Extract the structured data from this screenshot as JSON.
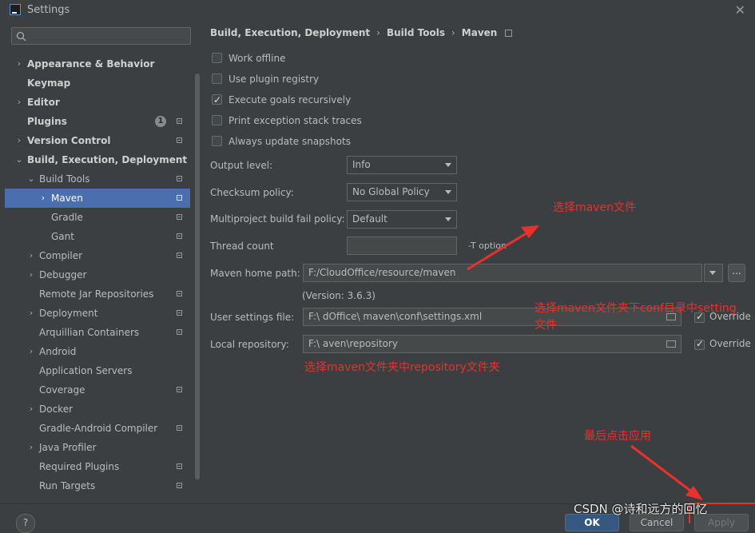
{
  "window": {
    "title": "Settings",
    "close_glyph": "✕"
  },
  "sidebar": {
    "search_placeholder": "",
    "items": [
      {
        "label": "Appearance & Behavior",
        "bold": true,
        "arrow": "›",
        "indent": 0
      },
      {
        "label": "Keymap",
        "bold": true,
        "arrow": "",
        "indent": 0
      },
      {
        "label": "Editor",
        "bold": true,
        "arrow": "›",
        "indent": 0
      },
      {
        "label": "Plugins",
        "bold": true,
        "arrow": "",
        "indent": 0,
        "badge": "1",
        "pin": true
      },
      {
        "label": "Version Control",
        "bold": true,
        "arrow": "›",
        "indent": 0,
        "pin": true
      },
      {
        "label": "Build, Execution, Deployment",
        "bold": true,
        "arrow": "⌄",
        "indent": 0
      },
      {
        "label": "Build Tools",
        "bold": false,
        "arrow": "⌄",
        "indent": 1,
        "pin": true
      },
      {
        "label": "Maven",
        "bold": false,
        "arrow": "›",
        "indent": 2,
        "pin": true,
        "selected": true
      },
      {
        "label": "Gradle",
        "bold": false,
        "arrow": "",
        "indent": 2,
        "pin": true
      },
      {
        "label": "Gant",
        "bold": false,
        "arrow": "",
        "indent": 2,
        "pin": true
      },
      {
        "label": "Compiler",
        "bold": false,
        "arrow": "›",
        "indent": 1,
        "pin": true
      },
      {
        "label": "Debugger",
        "bold": false,
        "arrow": "›",
        "indent": 1
      },
      {
        "label": "Remote Jar Repositories",
        "bold": false,
        "arrow": "",
        "indent": 1,
        "pin": true
      },
      {
        "label": "Deployment",
        "bold": false,
        "arrow": "›",
        "indent": 1,
        "pin": true
      },
      {
        "label": "Arquillian Containers",
        "bold": false,
        "arrow": "",
        "indent": 1,
        "pin": true
      },
      {
        "label": "Android",
        "bold": false,
        "arrow": "›",
        "indent": 1
      },
      {
        "label": "Application Servers",
        "bold": false,
        "arrow": "",
        "indent": 1
      },
      {
        "label": "Coverage",
        "bold": false,
        "arrow": "",
        "indent": 1,
        "pin": true
      },
      {
        "label": "Docker",
        "bold": false,
        "arrow": "›",
        "indent": 1
      },
      {
        "label": "Gradle-Android Compiler",
        "bold": false,
        "arrow": "",
        "indent": 1,
        "pin": true
      },
      {
        "label": "Java Profiler",
        "bold": false,
        "arrow": "›",
        "indent": 1
      },
      {
        "label": "Required Plugins",
        "bold": false,
        "arrow": "",
        "indent": 1,
        "pin": true
      },
      {
        "label": "Run Targets",
        "bold": false,
        "arrow": "",
        "indent": 1,
        "pin": true
      }
    ]
  },
  "breadcrumb": {
    "part1": "Build, Execution, Deployment",
    "part2": "Build Tools",
    "part3": "Maven",
    "sep": "›"
  },
  "checkboxes": [
    {
      "label": "Work offline",
      "checked": false
    },
    {
      "label": "Use plugin registry",
      "checked": false
    },
    {
      "label": "Execute goals recursively",
      "checked": true
    },
    {
      "label": "Print exception stack traces",
      "checked": false
    },
    {
      "label": "Always update snapshots",
      "checked": false
    }
  ],
  "fields": {
    "output_level_label": "Output level:",
    "output_level_value": "Info",
    "checksum_label": "Checksum policy:",
    "checksum_value": "No Global Policy",
    "multiproject_label": "Multiproject build fail policy:",
    "multiproject_value": "Default",
    "thread_count_label": "Thread count",
    "thread_count_value": "",
    "thread_option": "-T option",
    "maven_home_label": "Maven home path:",
    "maven_home_value": "F:/CloudOffice/resource/maven",
    "maven_version": "(Version: 3.6.3)",
    "user_settings_label": "User settings file:",
    "user_settings_value": "F:\\        dOffice\\             maven\\conf\\settings.xml",
    "local_repo_label": "Local repository:",
    "local_repo_value": "F:\\                               aven\\repository",
    "override_label": "Override",
    "dots": "..."
  },
  "annotations": {
    "select_maven": "选择maven文件",
    "select_settings_line1": "选择maven文件夹下conf目录中setting",
    "select_settings_line2": "文件",
    "select_repository": "选择maven文件夹中repository文件夹",
    "apply_note": "最后点击应用",
    "color": "#e8312b"
  },
  "footer": {
    "help": "?",
    "ok": "OK",
    "cancel": "Cancel",
    "apply": "Apply"
  },
  "watermark": "CSDN @诗和远方的回忆"
}
